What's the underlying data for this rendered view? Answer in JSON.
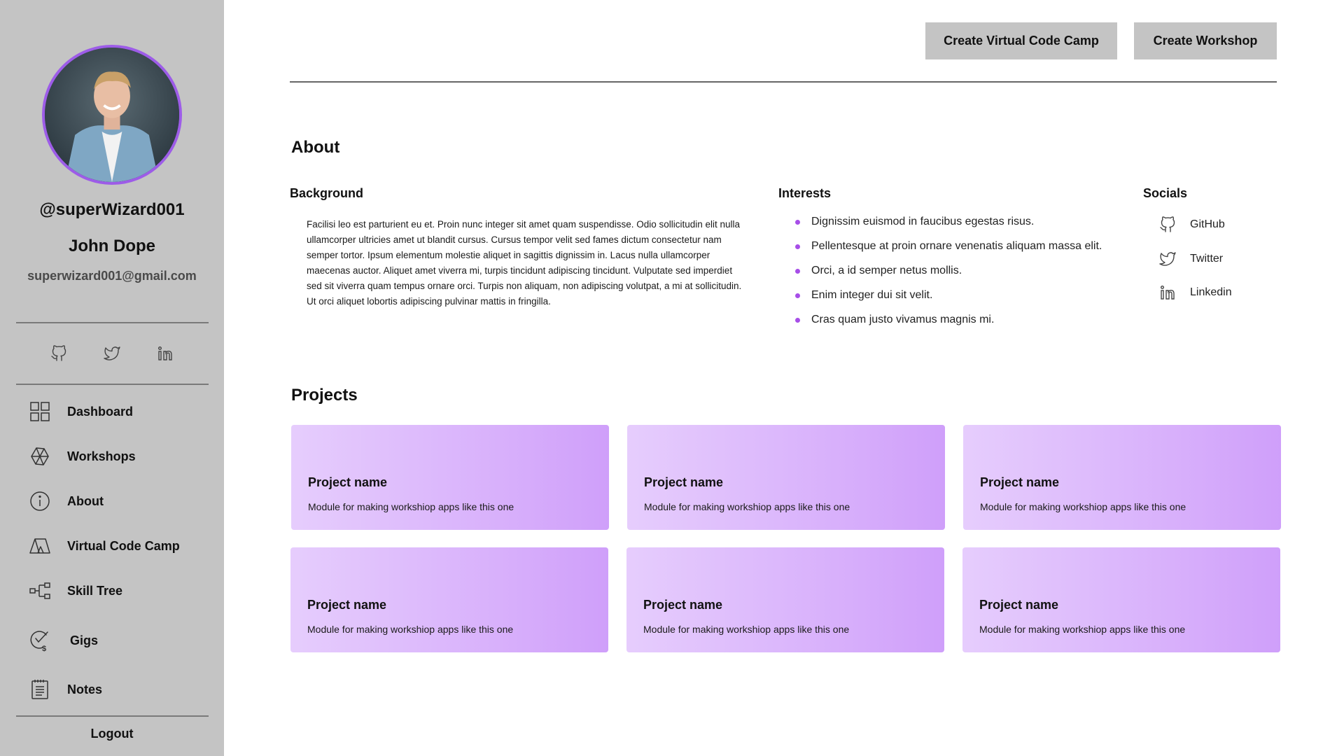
{
  "profile": {
    "username": "@superWizard001",
    "full_name": "John Dope",
    "email": "superwizard001@gmail.com"
  },
  "sidebar_socials": [
    "github-icon",
    "twitter-icon",
    "linkedin-icon"
  ],
  "nav": {
    "items": [
      {
        "label": "Dashboard",
        "icon": "dashboard-icon"
      },
      {
        "label": "Workshops",
        "icon": "workshops-icon"
      },
      {
        "label": "About",
        "icon": "info-icon"
      },
      {
        "label": "Virtual Code Camp",
        "icon": "tent-icon"
      },
      {
        "label": "Skill Tree",
        "icon": "skill-tree-icon"
      },
      {
        "label": "Gigs",
        "icon": "gigs-icon"
      },
      {
        "label": "Notes",
        "icon": "notes-icon"
      }
    ],
    "logout": "Logout"
  },
  "header": {
    "create_vcc": "Create Virtual Code Camp",
    "create_workshop": "Create Workshop"
  },
  "about": {
    "title": "About",
    "background": {
      "heading": "Background",
      "text": "Facilisi leo est parturient eu et. Proin nunc integer sit amet quam suspendisse. Odio sollicitudin elit nulla ullamcorper ultricies amet ut blandit cursus. Cursus tempor velit sed fames dictum consectetur nam semper tortor. Ipsum elementum molestie aliquet in sagittis dignissim in. Lacus nulla ullamcorper maecenas auctor. Aliquet amet viverra mi, turpis tincidunt adipiscing tincidunt. Vulputate sed imperdiet sed sit viverra quam tempus ornare orci. Turpis non aliquam, non adipiscing volutpat, a mi at sollicitudin. Ut orci aliquet lobortis adipiscing pulvinar mattis in fringilla."
    },
    "interests": {
      "heading": "Interests",
      "items": [
        "Dignissim euismod in faucibus egestas risus.",
        "Pellentesque at proin ornare venenatis aliquam massa elit.",
        "Orci, a id semper netus mollis.",
        "Enim integer dui sit velit.",
        "Cras quam justo vivamus magnis mi."
      ]
    },
    "socials": {
      "heading": "Socials",
      "items": [
        {
          "label": "GitHub",
          "icon": "github-icon"
        },
        {
          "label": "Twitter",
          "icon": "twitter-icon"
        },
        {
          "label": "Linkedin",
          "icon": "linkedin-icon"
        }
      ]
    }
  },
  "projects": {
    "title": "Projects",
    "items": [
      {
        "name": "Project name",
        "description": "Module for making workshiop apps like this one"
      },
      {
        "name": "Project name",
        "description": "Module for making workshiop apps like this one"
      },
      {
        "name": "Project name",
        "description": "Module for making workshiop apps like this one"
      },
      {
        "name": "Project name",
        "description": "Module for making workshiop apps like this one"
      },
      {
        "name": "Project name",
        "description": "Module for making workshiop apps like this one"
      },
      {
        "name": "Project name",
        "description": "Module for making workshiop apps like this one"
      }
    ]
  },
  "colors": {
    "sidebar_bg": "#c4c4c4",
    "accent": "#9d5ce8",
    "bullet": "#a74ee8",
    "card_gradient_start": "#e6cdfd",
    "card_gradient_end": "#cf9ffa"
  }
}
